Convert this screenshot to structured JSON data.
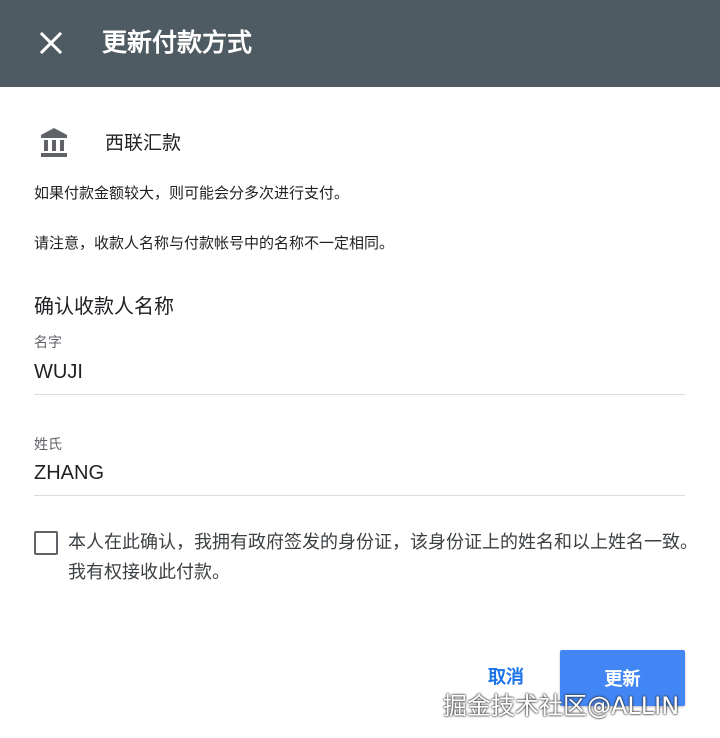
{
  "header": {
    "title": "更新付款方式",
    "close_icon": "close-icon",
    "background_color": "#4f5b62"
  },
  "method": {
    "icon": "bank-icon",
    "name": "西联汇款"
  },
  "notes": {
    "multiple_payments": "如果付款金额较大，则可能会分多次进行支付。",
    "name_mismatch": "请注意，收款人名称与付款帐号中的名称不一定相同。"
  },
  "recipient": {
    "section_title": "确认收款人名称",
    "first_name_label": "名字",
    "first_name_value": "WUJI",
    "last_name_label": "姓氏",
    "last_name_value": "ZHANG"
  },
  "consent": {
    "checked": false,
    "text": "本人在此确认，我拥有政府签发的身份证，该身份证上的姓名和以上姓名一致。我有权接收此付款。"
  },
  "actions": {
    "cancel_label": "取消",
    "update_label": "更新",
    "primary_color": "#4285f4",
    "link_color": "#1a73e8"
  },
  "watermark": {
    "text": "掘金技术社区@ALLIN"
  }
}
